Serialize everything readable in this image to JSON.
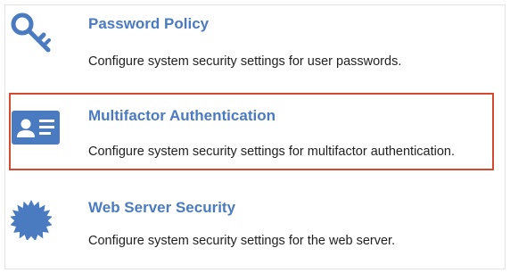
{
  "settings": {
    "items": [
      {
        "title": "Password Policy",
        "description": "Configure system security settings for user passwords.",
        "icon": "key-icon"
      },
      {
        "title": "Multifactor Authentication",
        "description": "Configure system security settings for multifactor authentication.",
        "icon": "id-card-icon"
      },
      {
        "title": "Web Server Security",
        "description": "Configure system security settings for the web server.",
        "icon": "seal-badge-icon"
      }
    ]
  },
  "colors": {
    "accent": "#4a7bc1",
    "highlight_border": "#d44a30",
    "text": "#1f1f1f"
  }
}
